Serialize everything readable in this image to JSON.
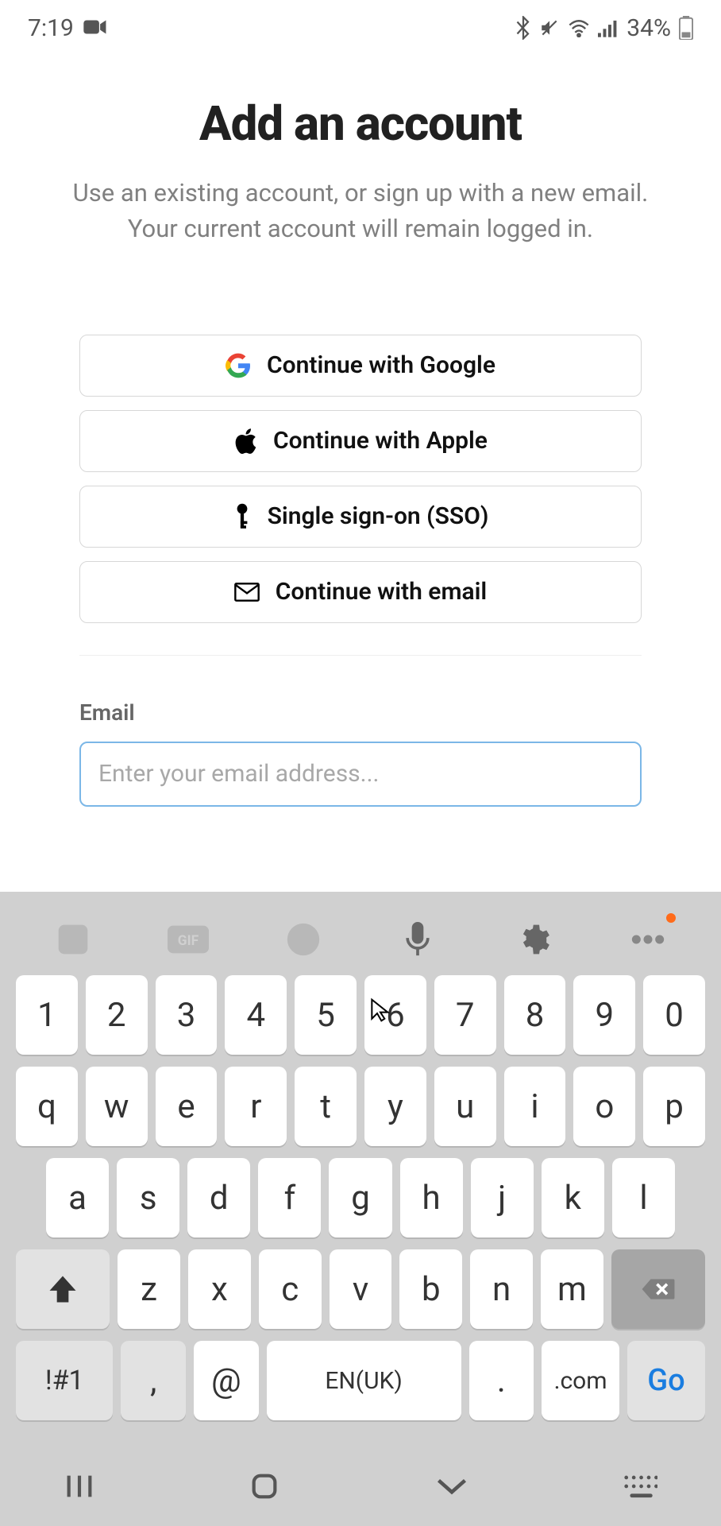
{
  "status": {
    "time": "7:19",
    "battery_pct": "34%"
  },
  "header": {
    "title": "Add an account",
    "subtitle": "Use an existing account, or sign up with a new email. Your current account will remain logged in."
  },
  "auth_buttons": {
    "google": "Continue with Google",
    "apple": "Continue with Apple",
    "sso": "Single sign-on (SSO)",
    "email": "Continue with email"
  },
  "email_form": {
    "label": "Email",
    "placeholder": "Enter your email address...",
    "value": ""
  },
  "keyboard": {
    "row1": [
      "1",
      "2",
      "3",
      "4",
      "5",
      "6",
      "7",
      "8",
      "9",
      "0"
    ],
    "row2": [
      "q",
      "w",
      "e",
      "r",
      "t",
      "y",
      "u",
      "i",
      "o",
      "p"
    ],
    "row3": [
      "a",
      "s",
      "d",
      "f",
      "g",
      "h",
      "j",
      "k",
      "l"
    ],
    "row4": [
      "z",
      "x",
      "c",
      "v",
      "b",
      "n",
      "m"
    ],
    "sym_key": "!#1",
    "comma_key": ",",
    "at_key": "@",
    "space_label": "EN(UK)",
    "period_key": ".",
    "com_key": ".com",
    "go_key": "Go"
  }
}
